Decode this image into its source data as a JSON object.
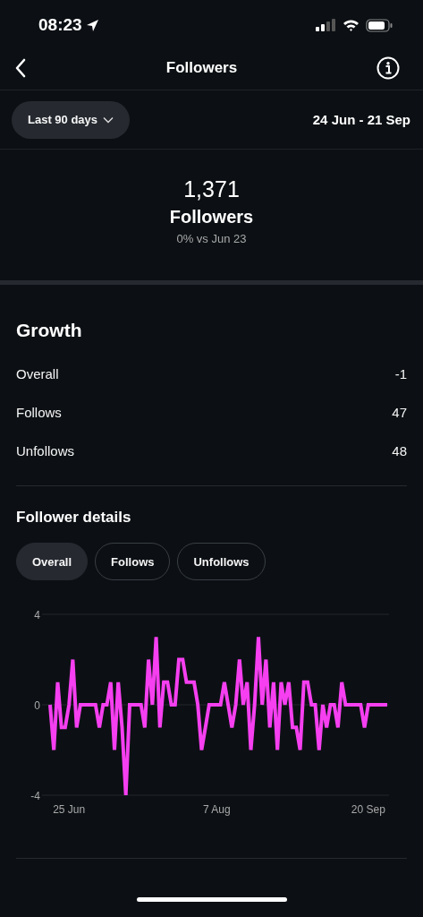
{
  "status_bar": {
    "time": "08:23"
  },
  "header": {
    "title": "Followers"
  },
  "filter": {
    "range": "Last 90 days",
    "dates": "24 Jun - 21 Sep"
  },
  "summary": {
    "count": "1,371",
    "label": "Followers",
    "comparison": "0% vs Jun 23"
  },
  "growth": {
    "title": "Growth",
    "rows": [
      {
        "label": "Overall",
        "value": "-1"
      },
      {
        "label": "Follows",
        "value": "47"
      },
      {
        "label": "Unfollows",
        "value": "48"
      }
    ]
  },
  "details": {
    "title": "Follower details",
    "tabs": [
      {
        "label": "Overall",
        "selected": true
      },
      {
        "label": "Follows",
        "selected": false
      },
      {
        "label": "Unfollows",
        "selected": false
      }
    ],
    "chart_data": {
      "type": "line",
      "categories": [
        null,
        null,
        null,
        null,
        null,
        "25 Jun",
        null,
        null,
        null,
        null,
        null,
        null,
        null,
        null,
        null,
        null,
        null,
        null,
        null,
        null,
        null,
        null,
        null,
        null,
        null,
        null,
        null,
        null,
        null,
        null,
        null,
        null,
        null,
        null,
        null,
        null,
        null,
        null,
        null,
        null,
        null,
        null,
        null,
        null,
        "7 Aug",
        null,
        null,
        null,
        null,
        null,
        null,
        null,
        null,
        null,
        null,
        null,
        null,
        null,
        null,
        null,
        null,
        null,
        null,
        null,
        null,
        null,
        null,
        null,
        null,
        null,
        null,
        null,
        null,
        null,
        null,
        null,
        null,
        null,
        null,
        null,
        null,
        null,
        null,
        null,
        "20 Sep",
        null,
        null,
        null,
        null,
        null
      ],
      "ylim": [
        -4,
        4
      ],
      "yticks": [
        -4,
        0,
        4
      ],
      "series": [
        {
          "color": "#f53ff0",
          "values": [
            0,
            -2,
            1,
            -1,
            -1,
            0,
            2,
            -1,
            0,
            0,
            0,
            0,
            0,
            -1,
            0,
            0,
            1,
            -2,
            1,
            -1,
            -4,
            0,
            0,
            0,
            0,
            -1,
            2,
            0,
            3,
            -1,
            1,
            1,
            0,
            0,
            2,
            2,
            1,
            1,
            1,
            0,
            -2,
            -1,
            0,
            0,
            0,
            0,
            1,
            0,
            -1,
            0,
            2,
            0,
            1,
            -2,
            0,
            3,
            0,
            2,
            -1,
            1,
            -2,
            1,
            0,
            1,
            -1,
            -1,
            -2,
            1,
            1,
            0,
            0,
            -2,
            0,
            -1,
            0,
            0,
            -1,
            1,
            0,
            0,
            0,
            0,
            0,
            -1,
            0,
            0,
            0,
            0,
            0,
            0
          ]
        }
      ]
    }
  }
}
